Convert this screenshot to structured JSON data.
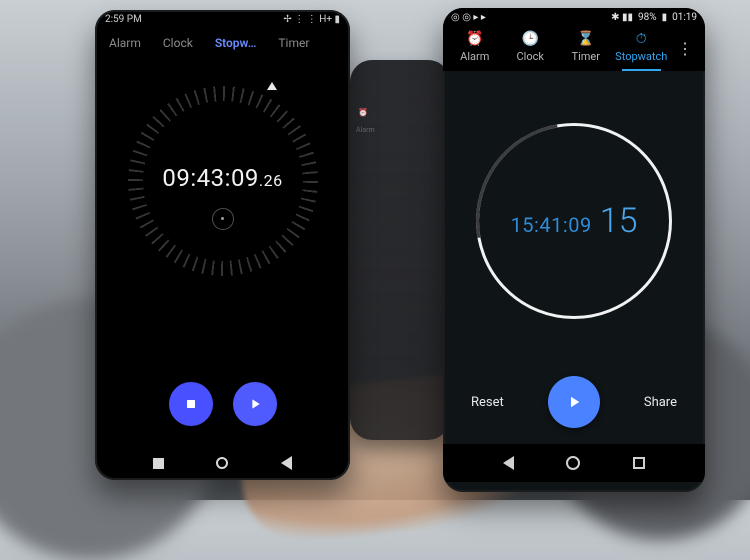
{
  "phone_left": {
    "status": {
      "time": "2:59 PM",
      "indicators": "✢ ⋮ ⋮  H+ ▮"
    },
    "tabs": {
      "alarm": "Alarm",
      "clock": "Clock",
      "stopwatch": "Stopw…",
      "timer": "Timer"
    },
    "stopwatch": {
      "hms": "09:43:09",
      "centis": ".26"
    },
    "nav_labels": {
      "recent": "recent-apps",
      "home": "home",
      "back": "back"
    }
  },
  "phone_right": {
    "status": {
      "icons_left": "◎ ◎ ▸ ▸",
      "signal": "✱ ▮▮",
      "battery_text": "98%",
      "clock": "01:19"
    },
    "tabs": {
      "alarm": "Alarm",
      "clock": "Clock",
      "timer": "Timer",
      "stopwatch": "Stopwatch"
    },
    "stopwatch": {
      "hms": "15:41:09",
      "centis": "15"
    },
    "actions": {
      "reset": "Reset",
      "share": "Share"
    }
  },
  "phone_mid": {
    "alarm_icon_label": "⏰",
    "alarm_text": "Alarm"
  }
}
